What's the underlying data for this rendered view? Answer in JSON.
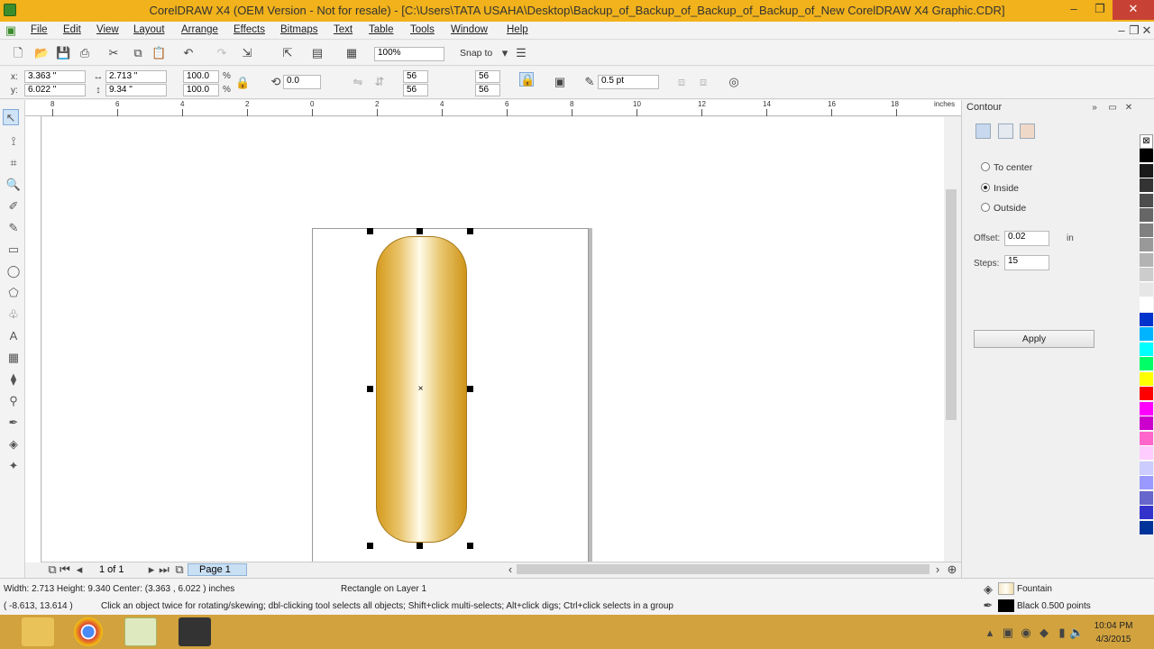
{
  "window": {
    "title": "CorelDRAW X4 (OEM Version - Not for resale) - [C:\\Users\\TATA USAHA\\Desktop\\Backup_of_Backup_of_Backup_of_Backup_of_New CorelDRAW X4 Graphic.CDR]",
    "minimize_label": "–",
    "maximize_label": "❐",
    "close_label": "✕"
  },
  "menu": [
    "File",
    "Edit",
    "View",
    "Layout",
    "Arrange",
    "Effects",
    "Bitmaps",
    "Text",
    "Table",
    "Tools",
    "Window",
    "Help"
  ],
  "toolbar": {
    "zoom": "100%",
    "snap_to": "Snap to"
  },
  "property_bar": {
    "x": "3.363 \"",
    "y": "6.022 \"",
    "width": "2.713 \"",
    "height": "9.34 \"",
    "scale_x": "100.0",
    "scale_y": "100.0",
    "percent": "%",
    "rotation": "0.0",
    "corner_tl": "56",
    "corner_bl": "56",
    "corner_tr": "56",
    "corner_br": "56",
    "outline_width": "0.5 pt"
  },
  "ruler": {
    "units": "inches",
    "h_labels": [
      "8",
      "6",
      "4",
      "2",
      "0",
      "2",
      "4",
      "6",
      "8",
      "10",
      "12",
      "14",
      "16",
      "18"
    ]
  },
  "page_nav": {
    "count": "1 of 1",
    "tab": "Page 1"
  },
  "docker": {
    "title": "Contour",
    "options": [
      "To center",
      "Inside",
      "Outside"
    ],
    "selected": "Inside",
    "offset_label": "Offset:",
    "offset_value": "0.02",
    "offset_unit": "in",
    "steps_label": "Steps:",
    "steps_value": "15",
    "apply_label": "Apply"
  },
  "palette": [
    "#000000",
    "#1a1a1a",
    "#333333",
    "#4d4d4d",
    "#666666",
    "#808080",
    "#999999",
    "#b3b3b3",
    "#cccccc",
    "#e6e6e6",
    "#ffffff",
    "#0033cc",
    "#00b4ff",
    "#00ffff",
    "#00ff66",
    "#ffff00",
    "#ff0000",
    "#ff00ff",
    "#cc00cc",
    "#ff66cc",
    "#ffccff",
    "#ccccff",
    "#9999ff",
    "#6666cc",
    "#3333cc",
    "#003399"
  ],
  "status": {
    "dimensions": "Width: 2.713  Height: 9.340  Center: (3.363 , 6.022 )  inches",
    "object_info": "Rectangle on Layer 1",
    "coords": "( -8.613, 13.614 )",
    "hint": "Click an object twice for rotating/skewing; dbl-clicking tool selects all objects; Shift+click multi-selects; Alt+click digs; Ctrl+click selects in a group",
    "fill_type": "Fountain",
    "outline_info": "Black  0.500 points"
  },
  "taskbar": {
    "time": "10:04 PM",
    "date": "4/3/2015"
  },
  "colors": {
    "title_bar": "#f1b21b",
    "taskbar": "#d1a23e",
    "capsule_gold": "#d59b1d"
  }
}
